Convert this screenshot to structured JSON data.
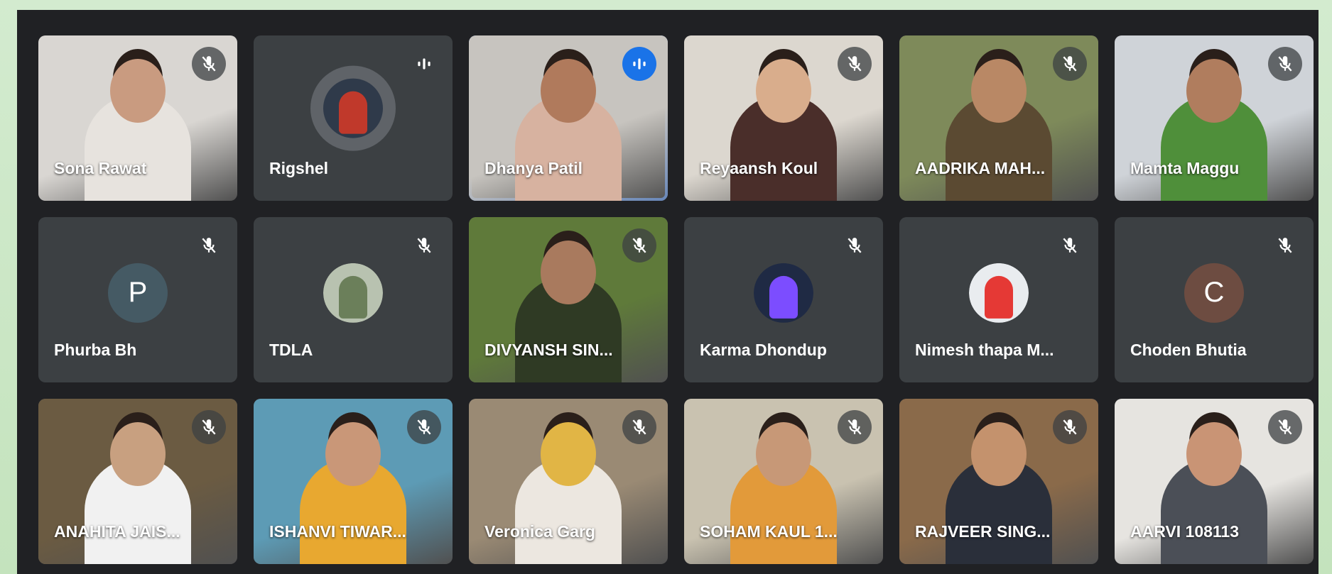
{
  "meeting": {
    "participants": [
      {
        "name": "Sona Rawat",
        "muted": true,
        "kind": "video",
        "bg": "#d9d6d2",
        "shirt": "#e7e3de",
        "face": "#c99b80"
      },
      {
        "name": "Rigshel",
        "muted": false,
        "kind": "avatar-photo",
        "avatar_bg": "#2f3a4a",
        "avatar_fg": "#c0392b"
      },
      {
        "name": "Dhanya Patil",
        "muted": false,
        "kind": "video",
        "speaking": true,
        "bg": "#c7c4bf",
        "shirt": "#d7b2a0",
        "face": "#b07a5c"
      },
      {
        "name": "Reyaansh Koul",
        "muted": true,
        "kind": "video",
        "bg": "#dcd7cf",
        "shirt": "#4a2e2a",
        "face": "#d9ad8c"
      },
      {
        "name": "AADRIKA MAH...",
        "muted": true,
        "kind": "video",
        "bg": "#7e8a5a",
        "shirt": "#5b4a32",
        "face": "#b98865"
      },
      {
        "name": "Mamta Maggu",
        "muted": true,
        "kind": "video",
        "bg": "#cfd3d8",
        "shirt": "#4f8f3a",
        "face": "#b07d5e"
      },
      {
        "name": "Phurba Bh",
        "muted": true,
        "kind": "initial",
        "initial": "P",
        "avatar_bg": "#455a64"
      },
      {
        "name": "TDLA",
        "muted": true,
        "kind": "avatar-photo",
        "avatar_bg": "#b8c2b0",
        "avatar_fg": "#6b7f5a"
      },
      {
        "name": "DIVYANSH SIN...",
        "muted": true,
        "kind": "video",
        "bg": "#5f7a3a",
        "shirt": "#2f3a24",
        "face": "#a97a5e"
      },
      {
        "name": "Karma Dhondup",
        "muted": true,
        "kind": "avatar-photo",
        "avatar_bg": "#1f2a44",
        "avatar_fg": "#7c4dff"
      },
      {
        "name": "Nimesh thapa M...",
        "muted": true,
        "kind": "avatar-photo",
        "avatar_bg": "#e9ecef",
        "avatar_fg": "#e53935"
      },
      {
        "name": "Choden Bhutia",
        "muted": true,
        "kind": "initial",
        "initial": "C",
        "avatar_bg": "#6d4c41"
      },
      {
        "name": "ANAHITA JAIS...",
        "muted": true,
        "kind": "video",
        "bg": "#6b5b42",
        "shirt": "#f1f1f1",
        "face": "#c8a080"
      },
      {
        "name": "ISHANVI TIWAR...",
        "muted": true,
        "kind": "video",
        "bg": "#5d9bb5",
        "shirt": "#e8a830",
        "face": "#c99778"
      },
      {
        "name": "Veronica Garg",
        "muted": true,
        "kind": "video",
        "bg": "#9a8a74",
        "shirt": "#ece7e0",
        "face": "#e1b545"
      },
      {
        "name": "SOHAM KAUL 1...",
        "muted": true,
        "kind": "video",
        "bg": "#c9c2b0",
        "shirt": "#e29a3a",
        "face": "#c79877"
      },
      {
        "name": "RAJVEER SING...",
        "muted": true,
        "kind": "video",
        "bg": "#8a6a4a",
        "shirt": "#2a2f3a",
        "face": "#c4926d"
      },
      {
        "name": "AARVI 108113",
        "muted": true,
        "kind": "video",
        "bg": "#e6e4e0",
        "shirt": "#4b4f57",
        "face": "#c99475"
      }
    ]
  }
}
